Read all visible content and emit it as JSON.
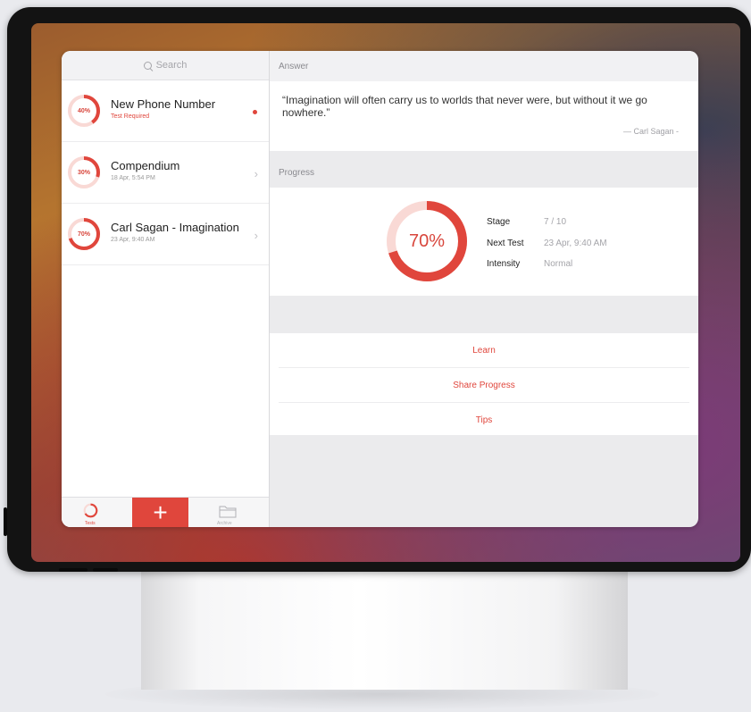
{
  "search": {
    "placeholder": "Search"
  },
  "items": [
    {
      "title": "New Phone Number",
      "subtitle": "Test Required",
      "progress": 40,
      "progress_label": "40%",
      "unread": true
    },
    {
      "title": "Compendium",
      "subtitle": "18 Apr, 5:54 PM",
      "progress": 30,
      "progress_label": "30%",
      "unread": false
    },
    {
      "title": "Carl Sagan - Imagination",
      "subtitle": "23 Apr, 9:40 AM",
      "progress": 70,
      "progress_label": "70%",
      "unread": false
    }
  ],
  "tabbar": {
    "tests_label": "Tests",
    "archive_label": "Archive",
    "add_label": "+"
  },
  "answer": {
    "heading": "Answer",
    "quote": "“Imagination will often carry us to worlds that never were, but without it we go nowhere.”",
    "author": "— Carl Sagan -"
  },
  "progress": {
    "heading": "Progress",
    "percent": 70,
    "percent_label": "70%",
    "stats": [
      {
        "label": "Stage",
        "value": "7 / 10"
      },
      {
        "label": "Next Test",
        "value": "23 Apr, 9:40 AM"
      },
      {
        "label": "Intensity",
        "value": "Normal"
      }
    ]
  },
  "actions": [
    "Learn",
    "Share Progress",
    "Tips"
  ],
  "colors": {
    "accent": "#e0463c",
    "ring_track": "#f9d9d5"
  }
}
